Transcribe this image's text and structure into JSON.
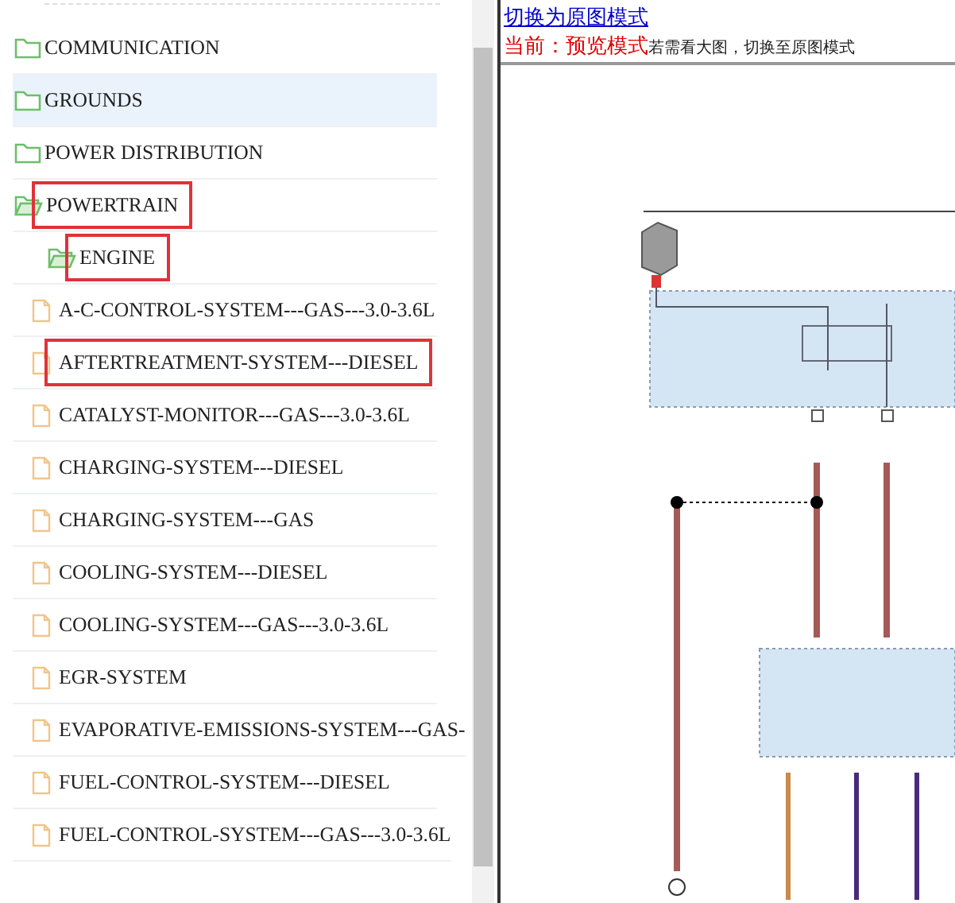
{
  "tree": {
    "items": [
      {
        "kind": "folder",
        "label": "COMMUNICATION",
        "selected": false,
        "expanded": false,
        "highlighted": false
      },
      {
        "kind": "folder",
        "label": "GROUNDS",
        "selected": true,
        "expanded": false,
        "highlighted": false
      },
      {
        "kind": "folder",
        "label": "POWER DISTRIBUTION",
        "selected": false,
        "expanded": false,
        "highlighted": false
      },
      {
        "kind": "folder",
        "label": "POWERTRAIN",
        "selected": false,
        "expanded": true,
        "highlighted": true,
        "children": [
          {
            "kind": "folder",
            "label": "ENGINE",
            "selected": false,
            "expanded": true,
            "highlighted": true,
            "children": [
              {
                "kind": "file",
                "label": "A-C-CONTROL-SYSTEM---GAS---3.0-3.6L",
                "selected": false,
                "highlighted": false
              },
              {
                "kind": "file",
                "label": "AFTERTREATMENT-SYSTEM---DIESEL",
                "selected": false,
                "highlighted": true
              },
              {
                "kind": "file",
                "label": "CATALYST-MONITOR---GAS---3.0-3.6L",
                "selected": false,
                "highlighted": false
              },
              {
                "kind": "file",
                "label": "CHARGING-SYSTEM---DIESEL",
                "selected": false,
                "highlighted": false
              },
              {
                "kind": "file",
                "label": "CHARGING-SYSTEM---GAS",
                "selected": false,
                "highlighted": false
              },
              {
                "kind": "file",
                "label": "COOLING-SYSTEM---DIESEL",
                "selected": false,
                "highlighted": false
              },
              {
                "kind": "file",
                "label": "COOLING-SYSTEM---GAS---3.0-3.6L",
                "selected": false,
                "highlighted": false
              },
              {
                "kind": "file",
                "label": "EGR-SYSTEM",
                "selected": false,
                "highlighted": false
              },
              {
                "kind": "file",
                "label": "EVAPORATIVE-EMISSIONS-SYSTEM---GAS-",
                "selected": false,
                "highlighted": false
              },
              {
                "kind": "file",
                "label": "FUEL-CONTROL-SYSTEM---DIESEL",
                "selected": false,
                "highlighted": false
              },
              {
                "kind": "file",
                "label": "FUEL-CONTROL-SYSTEM---GAS---3.0-3.6L",
                "selected": false,
                "highlighted": false
              }
            ]
          }
        ]
      }
    ]
  },
  "preview": {
    "switch_link": "切换为原图模式",
    "mode_label": "当前：预览模式",
    "mode_hint": "若需看大图，切换至原图模式"
  }
}
